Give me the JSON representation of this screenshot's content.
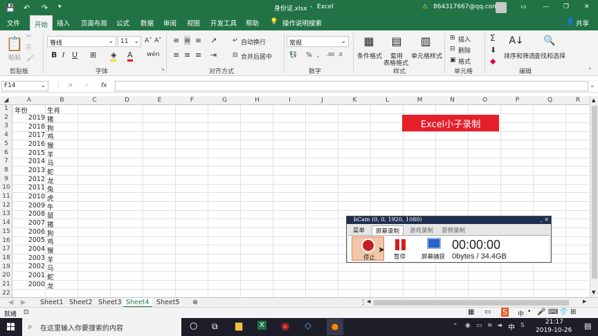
{
  "title": {
    "filename": "身份证.xlsx",
    "app": "Excel",
    "account": "864317667@qq.com"
  },
  "menu": {
    "items": [
      "文件",
      "开始",
      "插入",
      "页面布局",
      "公式",
      "数据",
      "审阅",
      "视图",
      "开发工具",
      "帮助"
    ],
    "search": "操作说明搜索",
    "share": "共享"
  },
  "ribbon": {
    "paste": "粘贴",
    "clipboard": "剪贴板",
    "font_name": "等线",
    "font_size": "11",
    "font_group": "字体",
    "wrap": "自动换行",
    "merge": "合并后居中",
    "align_group": "对齐方式",
    "num_format": "常规",
    "num_group": "数字",
    "cond_format": "条件格式",
    "table_format_1": "套用",
    "table_format_2": "表格格式",
    "cell_style": "单元格样式",
    "style_group": "样式",
    "insert": "插入",
    "delete": "删除",
    "format": "格式",
    "cell_group": "单元格",
    "sort_filter": "排序和筛选",
    "find_select": "查找和选择",
    "edit_group": "编辑"
  },
  "formula_bar": {
    "name_box": "F14",
    "fx": "fx",
    "value": ""
  },
  "columns": [
    "A",
    "B",
    "C",
    "D",
    "E",
    "F",
    "G",
    "H",
    "I",
    "J",
    "K",
    "L",
    "M",
    "N",
    "O",
    "P",
    "Q",
    "R"
  ],
  "rows": [
    "1",
    "2",
    "3",
    "4",
    "5",
    "6",
    "7",
    "8",
    "9",
    "10",
    "11",
    "12",
    "13",
    "14",
    "15",
    "16",
    "17",
    "18",
    "19",
    "20",
    "21",
    "22"
  ],
  "header": {
    "year": "年份",
    "zodiac": "生肖"
  },
  "table": [
    {
      "year": "2019",
      "zodiac": "猪"
    },
    {
      "year": "2018",
      "zodiac": "狗"
    },
    {
      "year": "2017",
      "zodiac": "鸡"
    },
    {
      "year": "2016",
      "zodiac": "猴"
    },
    {
      "year": "2015",
      "zodiac": "羊"
    },
    {
      "year": "2014",
      "zodiac": "马"
    },
    {
      "year": "2013",
      "zodiac": "蛇"
    },
    {
      "year": "2012",
      "zodiac": "龙"
    },
    {
      "year": "2011",
      "zodiac": "兔"
    },
    {
      "year": "2010",
      "zodiac": "虎"
    },
    {
      "year": "2009",
      "zodiac": "牛"
    },
    {
      "year": "2008",
      "zodiac": "鼠"
    },
    {
      "year": "2007",
      "zodiac": "猪"
    },
    {
      "year": "2006",
      "zodiac": "狗"
    },
    {
      "year": "2005",
      "zodiac": "鸡"
    },
    {
      "year": "2004",
      "zodiac": "猴"
    },
    {
      "year": "2003",
      "zodiac": "羊"
    },
    {
      "year": "2002",
      "zodiac": "马"
    },
    {
      "year": "2001",
      "zodiac": "蛇"
    },
    {
      "year": "2000",
      "zodiac": "龙"
    }
  ],
  "stamp": "Excel小子录制",
  "bandicam": {
    "title": "bCam (0, 0, 1920, 1080)",
    "tabs": [
      "菜单",
      "屏幕录制",
      "游戏录制",
      "音频录制"
    ],
    "stop": "停止",
    "pause": "暂停",
    "capture": "屏幕捕获",
    "time": "00:00:00",
    "size": "0bytes / 34.4GB"
  },
  "sheets": [
    "Sheet1",
    "Sheet2",
    "Sheet3",
    "Sheet4",
    "Sheet5"
  ],
  "active_sheet": "Sheet4",
  "status": {
    "ready": "就绪"
  },
  "taskbar": {
    "search": "在这里输入你要搜索的内容",
    "time": "21:17",
    "date": "2019-10-26",
    "ime": "中"
  },
  "colors": {
    "excel_green": "#217346",
    "stamp_red": "#e5202a",
    "taskbar": "#1e1e2a"
  }
}
